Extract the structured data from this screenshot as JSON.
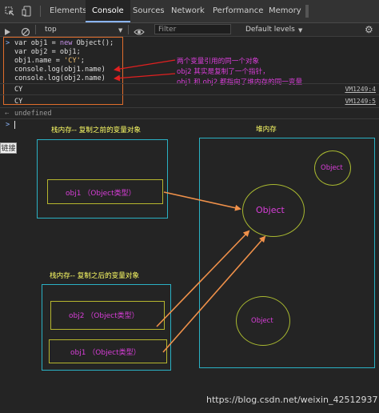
{
  "tabs": [
    "Elements",
    "Console",
    "Sources",
    "Network",
    "Performance",
    "Memory"
  ],
  "toolbar": {
    "context": "top",
    "filter_placeholder": "Filter",
    "levels": "Default levels"
  },
  "console": {
    "prompt": ">",
    "code": [
      {
        "pre": "var obj1 = ",
        "kw": "new",
        "post": " Object();"
      },
      {
        "pre": "var obj2 = obj1;",
        "kw": "",
        "post": ""
      },
      {
        "pre": "obj1.name = ",
        "kw": "",
        "post": "",
        "str": "'CY'",
        "end": ";"
      },
      {
        "pre": "console.log(obj1.name)",
        "kw": "",
        "post": ""
      },
      {
        "pre": "console.log(obj2.name)",
        "kw": "",
        "post": ""
      }
    ],
    "outputs": [
      {
        "text": "CY",
        "source": "VM1249:4"
      },
      {
        "text": "CY",
        "source": "VM1249:5"
      }
    ],
    "return_value": "undefined"
  },
  "annotations": [
    "两个变量引用的同一个对象",
    "obj2 其实是复制了一个指针，",
    "obj1 和 obj2 都指向了堆内存的同一变量"
  ],
  "side_tab_label": "链接",
  "diagram": {
    "stack_before_title": "栈内存-- 复制之前的变量对象",
    "heap_title": "堆内存",
    "stack_after_title": "栈内存-- 复制之后的变量对象",
    "obj1_before": "obj1 （Object类型）",
    "obj2_after": "obj2 （Object类型）",
    "obj1_after": "obj1 （Object类型）",
    "heap_objects": [
      "Object",
      "Object",
      "Object"
    ]
  },
  "watermark": "https://blog.csdn.net/weixin_42512937",
  "colors": {
    "annotation": "#d93ed9",
    "label": "#ffff66",
    "arrow": "#f0914a",
    "box_border": "#2ab1c4",
    "stack_box": "#b6b62e",
    "heap_circle": "#a8b830",
    "code_outline": "#e06d2c"
  },
  "icons": [
    "inspect-icon",
    "device-toggle-icon",
    "clear-console-icon",
    "eye-icon",
    "settings-icon"
  ]
}
